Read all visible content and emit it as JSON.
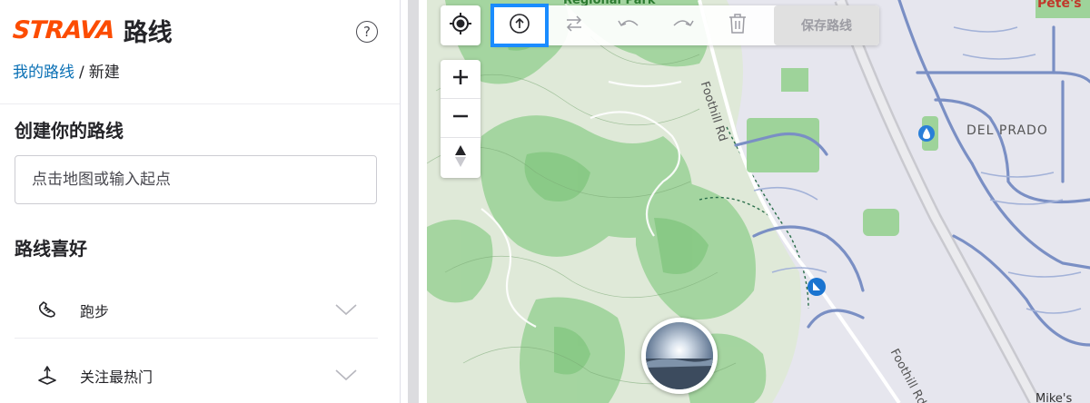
{
  "app": {
    "brand": "STRAVA",
    "title": "路线",
    "help_icon": "question-circle-icon"
  },
  "breadcrumb": {
    "link": "我的路线",
    "separator": "/",
    "current": "新建"
  },
  "create": {
    "heading": "创建你的路线",
    "input_placeholder": "点击地图或输入起点",
    "input_value": ""
  },
  "preferences": {
    "heading": "路线喜好",
    "items": [
      {
        "label": "跑步",
        "icon": "running-shoe-icon"
      },
      {
        "label": "关注最热门",
        "icon": "popularity-icon"
      }
    ]
  },
  "toolbar": {
    "tools": [
      {
        "icon": "upload-arrow-icon",
        "active": true
      },
      {
        "icon": "swap-arrows-icon",
        "active": false
      },
      {
        "icon": "undo-icon",
        "active": false
      },
      {
        "icon": "redo-icon",
        "active": false
      },
      {
        "icon": "trash-icon",
        "active": false
      }
    ],
    "save_label": "保存路线"
  },
  "map": {
    "labels": {
      "park": "Regional Park",
      "road_top": "Foothill Rd",
      "road_bottom": "Foothill Rd",
      "neighborhood": "DEL PRADO",
      "poi_top_right": "Pete's",
      "poi_bottom_right": "Mike's"
    },
    "colors": {
      "brand": "#fc4c02",
      "link": "#0a70b5",
      "active_tool_outline": "#1a8cff",
      "terrain_green": "#8fce8f",
      "road_blue": "#6b83b8"
    }
  }
}
